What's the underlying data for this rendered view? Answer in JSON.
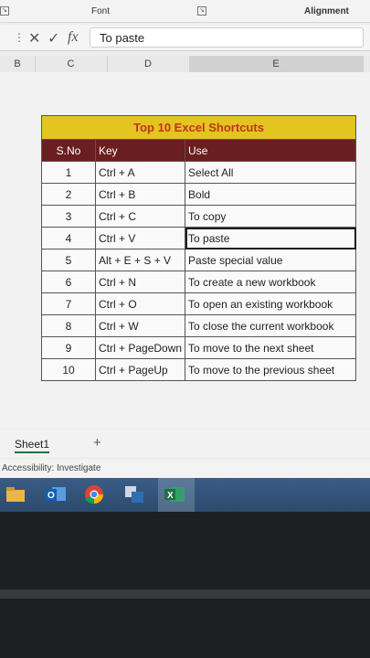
{
  "ribbon": {
    "font_label": "Font",
    "alignment_label": "Alignment"
  },
  "formula_bar": {
    "cell_value": "To paste"
  },
  "columns": [
    "B",
    "C",
    "D",
    "E"
  ],
  "table": {
    "title": "Top 10 Excel Shortcuts",
    "headers": [
      "S.No",
      "Key",
      "Use"
    ],
    "rows": [
      [
        "1",
        "Ctrl + A",
        "Select All"
      ],
      [
        "2",
        "Ctrl + B",
        "Bold"
      ],
      [
        "3",
        "Ctrl + C",
        "To copy"
      ],
      [
        "4",
        "Ctrl + V",
        "To paste"
      ],
      [
        "5",
        "Alt + E + S + V",
        "Paste special value"
      ],
      [
        "6",
        "Ctrl + N",
        "To create a new workbook"
      ],
      [
        "7",
        "Ctrl + O",
        "To open an existing workbook"
      ],
      [
        "8",
        "Ctrl + W",
        "To close the current workbook"
      ],
      [
        "9",
        "Ctrl + PageDown",
        "To move to the next sheet"
      ],
      [
        "10",
        "Ctrl + PageUp",
        "To move to the previous sheet"
      ]
    ]
  },
  "sheet_tabs": {
    "sheet1": "Sheet1",
    "add": "+"
  },
  "status_bar": {
    "accessibility": "Accessibility: Investigate"
  },
  "colors": {
    "title_bg": "#e2c51f",
    "title_text": "#c3331f",
    "header_bg": "#6b1e20",
    "taskbar": "#2c4a6c"
  },
  "icons": [
    "file-explorer-icon",
    "outlook-icon",
    "chrome-icon",
    "app-icon",
    "excel-icon"
  ]
}
